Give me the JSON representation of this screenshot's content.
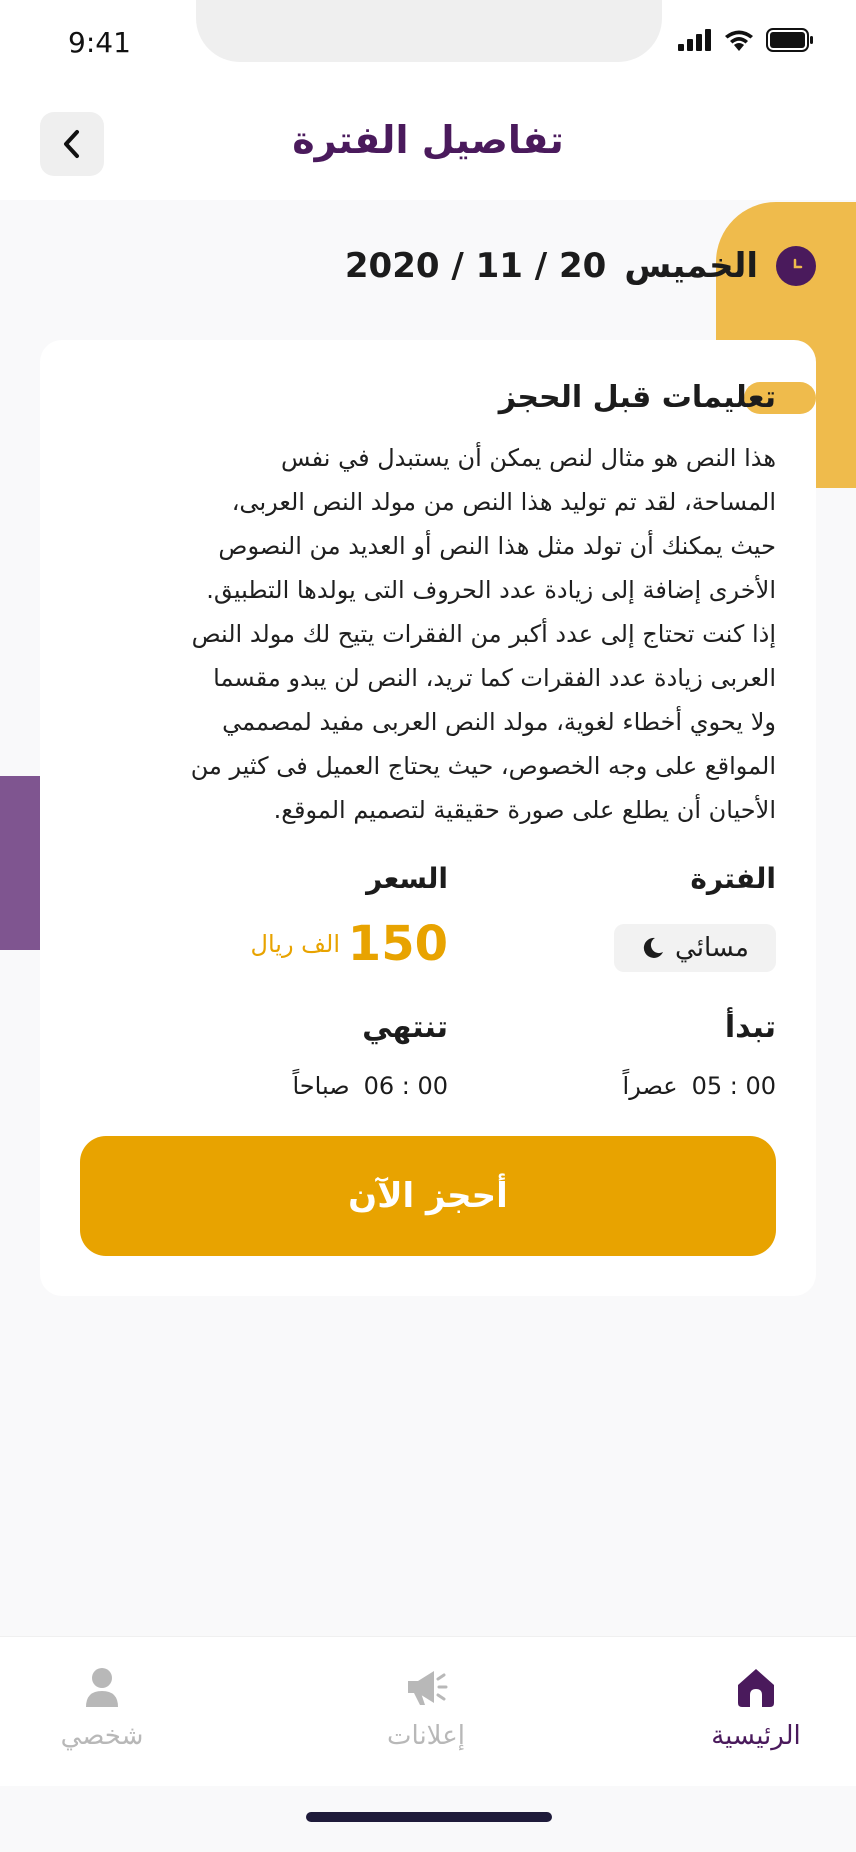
{
  "status_bar": {
    "time": "9:41"
  },
  "header": {
    "title": "تفاصيل الفترة"
  },
  "date": {
    "day": "الخميس",
    "value": "2020 / 11 / 20"
  },
  "instructions": {
    "title": "تعليمات  قبل الحجز",
    "lines": [
      "هذا النص هو مثال لنص يمكن أن يستبدل في نفس",
      "المساحة، لقد تم توليد هذا النص من مولد النص العربى،",
      "حيث يمكنك أن تولد مثل هذا النص أو العديد من النصوص",
      "الأخرى إضافة إلى زيادة عدد الحروف التى يولدها التطبيق.",
      "إذا كنت تحتاج إلى عدد أكبر من الفقرات يتيح لك مولد النص",
      "العربى زيادة عدد الفقرات كما تريد، النص لن يبدو مقسما",
      "ولا يحوي أخطاء لغوية، مولد النص العربى مفيد لمصممي",
      "المواقع على وجه الخصوص، حيث يحتاج العميل فى كثير من",
      "الأحيان أن يطلع على صورة حقيقية لتصميم الموقع."
    ]
  },
  "details": {
    "period_label": "الفترة",
    "period_value": "مسائي",
    "price_label": "السعر",
    "price_value": "150",
    "price_unit": "الف ريال",
    "start_label": "تبدأ",
    "start_time": "05 : 00",
    "start_period": "عصراً",
    "end_label": "تنتهي",
    "end_time": "06 : 00",
    "end_period": "صباحاً"
  },
  "book_button": "أحجز الآن",
  "nav": {
    "home": "الرئيسية",
    "ads": "إعلانات",
    "profile": "شخصي",
    "active_color": "#4a1a5c",
    "inactive_color": "#b8b8b8"
  },
  "colors": {
    "accent": "#e8a300",
    "brand": "#4a1a5c"
  }
}
